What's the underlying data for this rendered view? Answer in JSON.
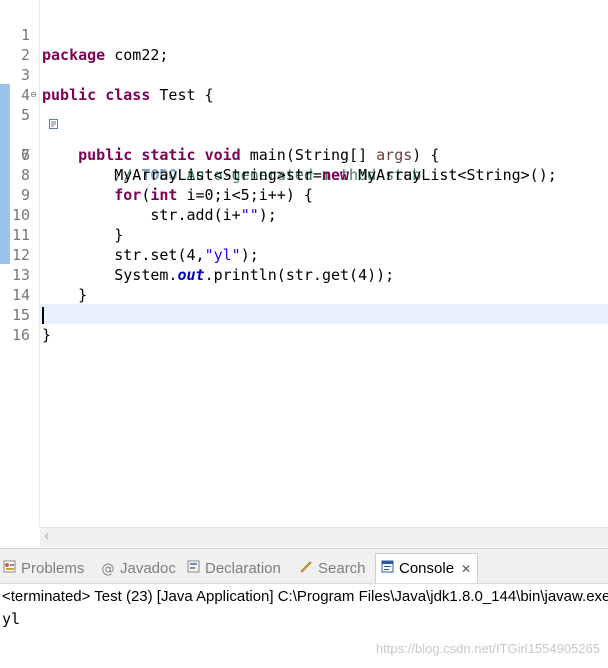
{
  "editor": {
    "line_numbers": [
      "1",
      "2",
      "3",
      "4",
      "5",
      "6",
      "7",
      "8",
      "9",
      "10",
      "11",
      "12",
      "13",
      "14",
      "15",
      "16"
    ],
    "lines": {
      "l1_kw": "package",
      "l1_rest": " com22;",
      "l3_kw1": "public",
      "l3_kw2": "class",
      "l3_rest": " Test {",
      "l5_indent": "    ",
      "l5_kw1": "public",
      "l5_kw2": "static",
      "l5_kw3": "void",
      "l5_mid": " main(String[] ",
      "l5_param": "args",
      "l5_end": ") {",
      "l6_indent": "        ",
      "l6_comment_start": "// ",
      "l6_todo": "TODO",
      "l6_comment_end": " Auto-generated method stub",
      "l7_indent": "        ",
      "l7_start": "MyArrayList<String>str=",
      "l7_kw": "new",
      "l7_end": " MyArrayList<String>();",
      "l8_indent": "        ",
      "l8_kw1": "for",
      "l8_mid1": "(",
      "l8_kw2": "int",
      "l8_end": " i=0;i<5;i++) {",
      "l9_indent": "            ",
      "l9_start": "str.add(i+",
      "l9_str": "\"\"",
      "l9_end": ");",
      "l10": "        }",
      "l11_indent": "        ",
      "l11_start": "str.set(4,",
      "l11_str": "\"yl\"",
      "l11_end": ");",
      "l12_indent": "        ",
      "l12_start": "System.",
      "l12_field": "out",
      "l12_end": ".println(str.get(4));",
      "l13": "    }",
      "l15": "}"
    }
  },
  "panel": {
    "tabs": {
      "problems": "Problems",
      "javadoc": "Javadoc",
      "declaration": "Declaration",
      "search": "Search",
      "console": "Console"
    },
    "console_status": "<terminated> Test (23) [Java Application] C:\\Program Files\\Java\\jdk1.8.0_144\\bin\\javaw.exe",
    "console_output": "yl",
    "watermark": "https://blog.csdn.net/ITGirl1554905265"
  },
  "icons": {
    "fold": "collapse-minus-icon",
    "task": "task-marker-icon",
    "problems": "problems-icon",
    "javadoc": "javadoc-icon",
    "declaration": "declaration-icon",
    "search": "search-icon",
    "console": "console-icon",
    "close": "close-icon",
    "scroll_left": "scroll-left-icon"
  },
  "colors": {
    "keyword": "#7f0055",
    "string": "#2a00ff",
    "comment": "#3f7f5f",
    "todo": "#7f9fbf",
    "current_line": "#e8f2fe",
    "change_bar": "#9ec3ea"
  }
}
